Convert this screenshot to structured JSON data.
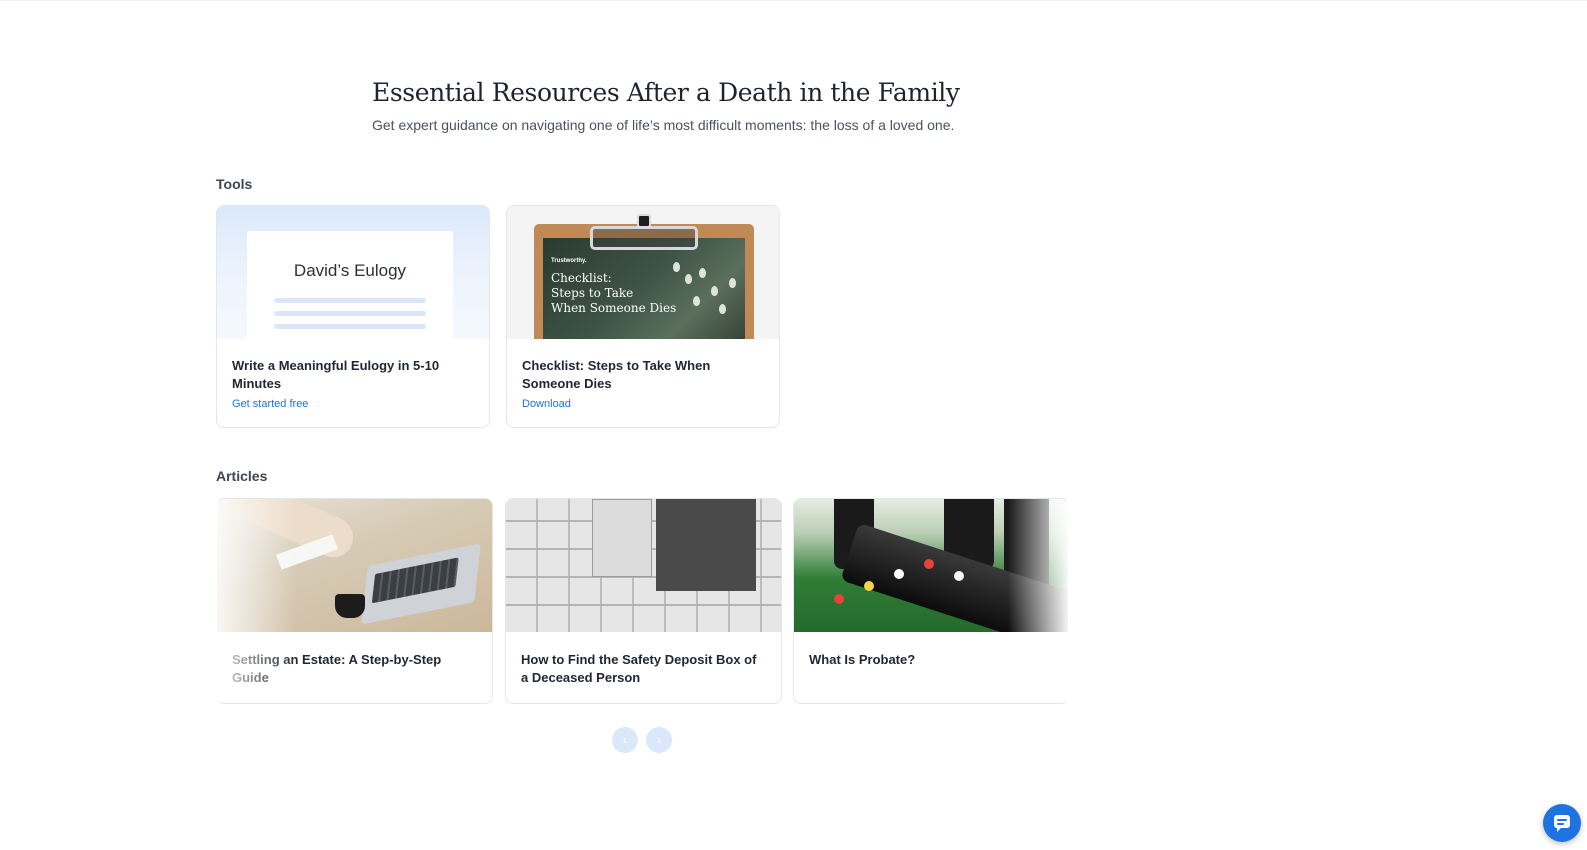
{
  "hero": {
    "title": "Essential Resources After a Death in the Family",
    "subtitle": "Get expert guidance on navigating one of life’s most difficult moments: the loss of a loved one."
  },
  "tools": {
    "label": "Tools",
    "items": [
      {
        "thumb_title": "David’s Eulogy",
        "title": "Write a Meaningful Eulogy in 5-10 Minutes",
        "link": "Get started free"
      },
      {
        "thumb_brand": "Trustworthy.",
        "thumb_title": "Checklist:\nSteps to Take\nWhen Someone Dies",
        "title": "Checklist: Steps to Take When Someone Dies",
        "link": "Download"
      }
    ]
  },
  "articles": {
    "label": "Articles",
    "items": [
      {
        "title": "Settling an Estate: A Step-by-Step Guide",
        "image": "laptop-paperwork-photo"
      },
      {
        "title": "How to Find the Safety Deposit Box of a Deceased Person",
        "image": "safety-deposit-boxes-photo"
      },
      {
        "title": "What Is Probate?",
        "image": "funeral-casket-photo"
      }
    ]
  },
  "carousel": {
    "prev_icon": "‹",
    "next_icon": "›"
  },
  "colors": {
    "link": "#1f73e0",
    "accent": "#1f73e0",
    "carousel_button": "#dbe7fb"
  },
  "icons": {
    "chat": "chat-icon",
    "prev": "chevron-left-icon",
    "next": "chevron-right-icon"
  }
}
